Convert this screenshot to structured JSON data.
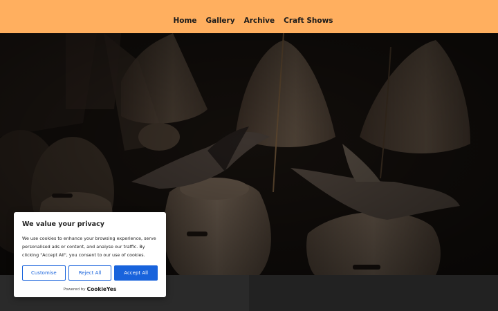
{
  "nav": {
    "items": [
      "Home",
      "Gallery",
      "Archive",
      "Craft Shows"
    ]
  },
  "hero": {
    "image": "dark-photo-ceramic-bird-bottles-and-conical-lampshades"
  },
  "cookie_banner": {
    "title": "We value your privacy",
    "body": "We use cookies to enhance your browsing experience, serve personalised ads or content, and analyse our traffic. By clicking \"Accept All\", you consent to our use of cookies.",
    "customise_label": "Customise",
    "reject_label": "Reject All",
    "accept_label": "Accept All",
    "powered_by": "Powered by",
    "brand": "CookieYes"
  },
  "colors": {
    "header": "#ffaf5f",
    "accent": "#1863dc",
    "footer_left": "#2a2a2a",
    "footer_right": "#222222"
  }
}
